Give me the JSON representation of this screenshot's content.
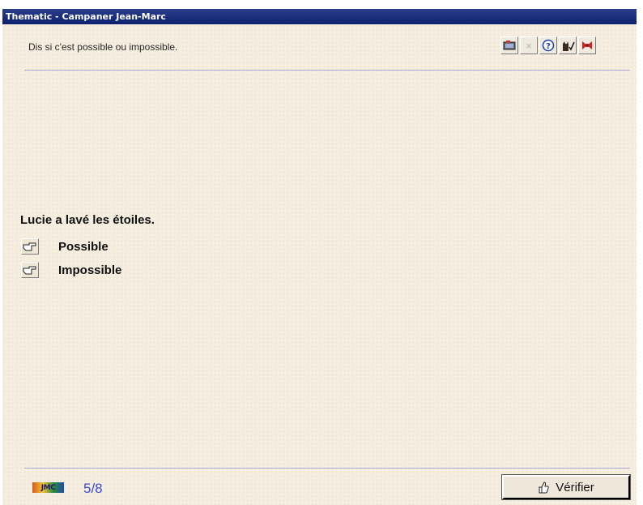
{
  "window": {
    "title": "Thematic - Campaner Jean-Marc"
  },
  "instruction": "Dis si c'est possible ou impossible.",
  "toolbar": [
    {
      "icon": "film-icon"
    },
    {
      "icon": "close-x-icon",
      "disabled": true
    },
    {
      "icon": "help-icon"
    },
    {
      "icon": "cat-check-icon"
    },
    {
      "icon": "bow-icon"
    }
  ],
  "question": "Lucie a lavé les étoiles.",
  "choices": [
    {
      "label": "Possible",
      "icon": "pointing-hand-icon"
    },
    {
      "label": "Impossible",
      "icon": "pointing-hand-icon"
    }
  ],
  "footer": {
    "logo": "JMC",
    "counter": "5/8",
    "verify_label": "Vérifier"
  },
  "colors": {
    "background": "#f6eee0",
    "titlebar": "#0c1f6e",
    "rule": "#a8a8d8",
    "counter": "#3a49d8"
  }
}
